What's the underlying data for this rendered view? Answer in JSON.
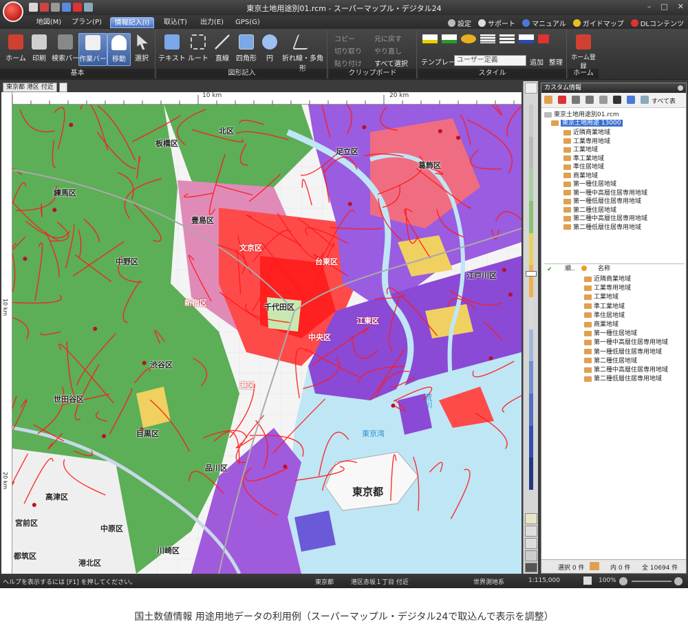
{
  "window": {
    "title": "東京土地用途別01.rcm - スーパーマップル・デジタル24",
    "controls": [
      "–",
      "□",
      "✕"
    ]
  },
  "menu": {
    "tabs": [
      "地図(M)",
      "プラン(P)",
      "情報記入(I)",
      "取込(T)",
      "出力(E)",
      "GPS(G)"
    ],
    "active_tab": "情報記入(I)",
    "links": [
      "設定",
      "サポート",
      "マニュアル",
      "ガイドマップ",
      "DLコンテンツ"
    ]
  },
  "ribbon": {
    "basic": {
      "label": "基本",
      "buttons": [
        "ホーム",
        "印刷",
        "検索バー",
        "作業バー",
        "移動",
        "選択"
      ]
    },
    "shapes": {
      "label": "図形記入",
      "buttons": [
        "テキスト",
        "ルート",
        "直線",
        "四角形",
        "円",
        "折れ線・多角形"
      ]
    },
    "clipboard": {
      "label": "クリップボード",
      "items": [
        "コピー",
        "切り取り",
        "貼り付け",
        "元に戻す",
        "やり直し",
        "すべて選択"
      ]
    },
    "style": {
      "label": "スタイル",
      "template_label": "テンプレート",
      "template_value": "ユーザー定義",
      "add": "追加",
      "arrange": "整理"
    },
    "home": {
      "label": "ホーム",
      "button": "ホーム登録"
    }
  },
  "doc_tab": "東京都 港区 付近",
  "map": {
    "ruler_top": [
      "10 km",
      "20 km"
    ],
    "ruler_left": [
      "10 km",
      "20 km"
    ],
    "labels": [
      "板橋区",
      "北区",
      "豊島区",
      "台東区",
      "足立区",
      "葛飾区",
      "中野区",
      "練馬区",
      "新宿区",
      "文京区",
      "千代田区",
      "中央区",
      "江東区",
      "港区",
      "江戸川区",
      "荒川",
      "渋谷区",
      "目黒区",
      "品川区",
      "世田谷区",
      "東京湾",
      "東京都",
      "高津区",
      "中原区",
      "港北区",
      "都筑区",
      "宮前区",
      "川崎区"
    ]
  },
  "panel": {
    "title": "カスタム情報",
    "show_all": "すべて表",
    "root": "東京土地用途別01.rcm",
    "layer": "東京土地用途 13000",
    "categories": [
      "近隣商業地域",
      "工業専用地域",
      "工業地域",
      "準工業地域",
      "準住居地域",
      "商業地域",
      "第一種住居地域",
      "第一種中高層住居専用地域",
      "第一種低層住居専用地域",
      "第二種住居地域",
      "第二種中高層住居専用地域",
      "第二種低層住居専用地域"
    ],
    "list_header": {
      "order": "順..",
      "name": "名称"
    },
    "footer": {
      "selected": "選択 0 件",
      "inner": "内 0 件",
      "total": "全 10694 件"
    }
  },
  "status": {
    "help": "ヘルプを表示するには [F1] を押してください。",
    "pref": "東京都",
    "addr": "港区赤坂１丁目 付近",
    "datum": "世界測地系",
    "scale": "1:115,000",
    "zoom": "100%"
  },
  "caption": "国土数値情報 用途用地データの利用例（スーパーマップル・デジタル24で取込んで表示を調整）",
  "colors": {
    "residential_low": "#4caa4c",
    "commercial": "#ff2a2a",
    "industrial": "#8a4ad6",
    "water": "#bfe6f5"
  }
}
